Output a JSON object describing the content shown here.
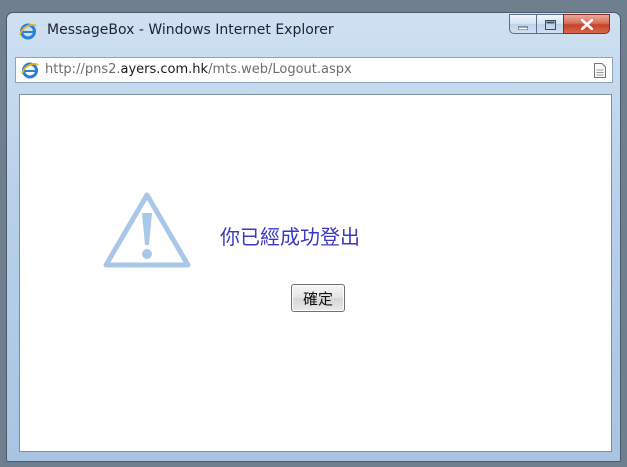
{
  "window": {
    "title": "MessageBox - Windows Internet Explorer",
    "icon": "internet-explorer-icon"
  },
  "controls": {
    "minimize_icon": "minimize-icon",
    "maximize_icon": "maximize-icon",
    "close_icon": "close-icon"
  },
  "address": {
    "prefix": "http://pns2.",
    "domain": "ayers.com.hk",
    "path": "/mts.web/Logout.aspx",
    "page_icon": "page-icon"
  },
  "dialog": {
    "icon": "warning-icon",
    "message": "你已經成功登出",
    "ok_label": "確定"
  },
  "colors": {
    "message": "#3a3ac3",
    "warning_icon": "#a9c8e8",
    "close_button": "#c4442a"
  }
}
